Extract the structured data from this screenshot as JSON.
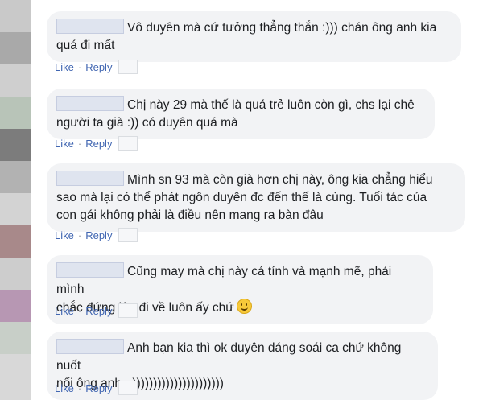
{
  "colors": {
    "link": "#4267b2",
    "bubble_bg": "#f2f3f5",
    "text": "#1c1e21",
    "separator": "#90949c"
  },
  "actions": {
    "like": "Like",
    "reply": "Reply",
    "separator": "·"
  },
  "comments": [
    {
      "line1": "Vô duyên mà cứ tưởng thẳng thắn :))) chán ông anh kia",
      "line2": "quá đi mất",
      "line3": ""
    },
    {
      "line1": "Chị này 29 mà thế là quá trẻ luôn còn gì, chs lại chê",
      "line2": "người ta già :)) có duyên quá mà",
      "line3": ""
    },
    {
      "line1": "Mình sn 93 mà còn già hơn chị này, ông kia chẳng hiểu",
      "line2": "sao mà lại có thể phát ngôn duyên đc đến thế là cùng. Tuổi tác của",
      "line3": "con gái không phải là điều nên mang ra bàn đâu"
    },
    {
      "line1": "Cũng may mà chị này cá tính và mạnh mẽ, phải mình",
      "line2": "chắc đứng lên đi về luôn ấy chứ",
      "line3": ""
    },
    {
      "line1": "Anh bạn kia thì ok duyên dáng soái ca chứ không nuốt",
      "line2": "nổi ông anh =))))))))))))))))))))))",
      "line3": ""
    }
  ]
}
